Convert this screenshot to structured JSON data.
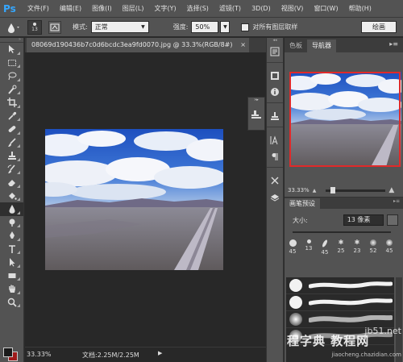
{
  "app": {
    "logo": "Ps"
  },
  "menu": [
    "文件(F)",
    "编辑(E)",
    "图像(I)",
    "图层(L)",
    "文字(Y)",
    "选择(S)",
    "滤镜(T)",
    "3D(D)",
    "视图(V)",
    "窗口(W)",
    "帮助(H)"
  ],
  "options": {
    "brush_size": "13",
    "mode_label": "模式:",
    "mode_value": "正常",
    "strength_label": "强度:",
    "strength_value": "50%",
    "sample_all_label": "对所有图层取样",
    "workspace": "绘画"
  },
  "document": {
    "tab_title": "08069d190436b7c0d6bcdc3ea9fd0070.jpg @ 33.3%(RGB/8#)",
    "close_glyph": "×",
    "zoom": "33.33%",
    "doc_info": "文档:2.25M/2.25M",
    "arrow": "▶"
  },
  "panels": {
    "tab_color": "色板",
    "tab_navigator": "导航器",
    "menu_glyph": "▸≡",
    "navigator_zoom": "33.33%",
    "brush_tab": "画笔预设",
    "size_label": "大小:",
    "size_value": "13 像素",
    "presets": [
      "45",
      "13",
      "45",
      "25",
      "23",
      "52",
      "45"
    ]
  },
  "watermark": {
    "line1": "程字典 教程网",
    "line2": "jb51.net",
    "line3": "jiaocheng.chazidian.com"
  },
  "colors": {
    "ui_panel": "#535353",
    "ui_dark": "#282828",
    "accent_blue": "#36a7ff",
    "nav_frame": "#e02a2a",
    "background_swatch": "#9e1b1b"
  },
  "icons": {
    "toolbar": [
      "move-icon",
      "marquee-icon",
      "lasso-icon",
      "quick-select-icon",
      "crop-icon",
      "eyedropper-icon",
      "healing-brush-icon",
      "brush-icon",
      "clone-stamp-icon",
      "history-brush-icon",
      "eraser-icon",
      "paint-bucket-icon",
      "blur-icon",
      "dodge-icon",
      "pen-icon",
      "type-icon",
      "path-select-icon",
      "rectangle-icon",
      "hand-icon",
      "zoom-icon"
    ]
  }
}
